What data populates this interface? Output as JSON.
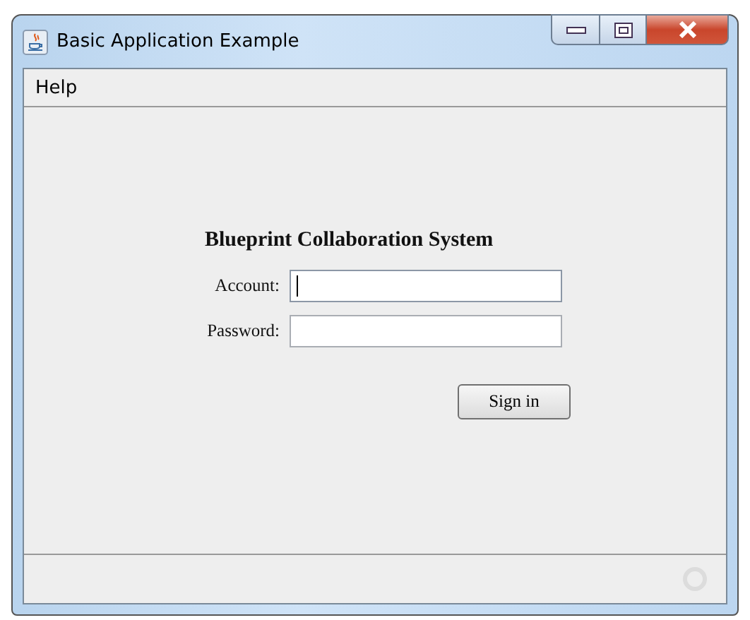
{
  "window": {
    "title": "Basic Application Example"
  },
  "menu": [
    {
      "label": "Help"
    }
  ],
  "form": {
    "title": "Blueprint Collaboration System",
    "fields": [
      {
        "label": "Account:",
        "focused": true
      },
      {
        "label": "Password:",
        "focused": false
      }
    ],
    "button": "Sign in"
  },
  "status_bar": {
    "busy": true
  }
}
